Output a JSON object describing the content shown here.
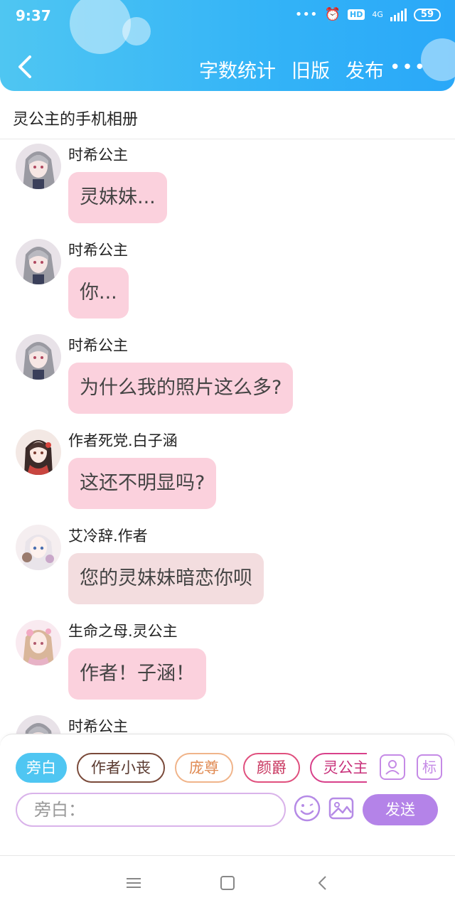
{
  "status_bar": {
    "time": "9:37",
    "network": "4G",
    "hd": "HD",
    "battery": "59"
  },
  "header": {
    "actions": [
      "字数统计",
      "旧版",
      "发布"
    ],
    "more": "•••"
  },
  "page_title": "灵公主的手机相册",
  "messages": [
    {
      "sender": "时希公主",
      "text": "灵妹妹...",
      "avatar": "avatar-shixi"
    },
    {
      "sender": "时希公主",
      "text": "你...",
      "avatar": "avatar-shixi"
    },
    {
      "sender": "时希公主",
      "text": "为什么我的照片这么多?",
      "avatar": "avatar-shixi"
    },
    {
      "sender": "作者死党.白子涵",
      "text": "这还不明显吗?",
      "avatar": "avatar-baizihan"
    },
    {
      "sender": "艾冷辞.作者",
      "text": "您的灵妹妹暗恋你呗",
      "avatar": "avatar-ailengci"
    },
    {
      "sender": "生命之母.灵公主",
      "text": "作者！子涵！",
      "avatar": "avatar-linggongzhu"
    },
    {
      "sender": "时希公主",
      "text": "",
      "avatar": "avatar-shixi"
    }
  ],
  "role_chips": [
    "旁白",
    "作者小丧",
    "庞尊",
    "颜爵",
    "灵公主"
  ],
  "side_icons": {
    "profile": "avatar-icon",
    "tag_label": "标"
  },
  "input": {
    "placeholder": "旁白：",
    "value": ""
  },
  "send_label": "发送",
  "icons": {
    "back": "chevron-left-icon",
    "emoji": "emoji-icon",
    "image": "image-icon",
    "sys_menu": "menu-icon",
    "sys_home": "home-icon",
    "sys_back": "back-icon"
  },
  "colors": {
    "header_blue": "#33b3f7",
    "bubble_pink": "#fbd1dd",
    "chip_active": "#4fc6f2",
    "send_purple": "#b483e8"
  }
}
